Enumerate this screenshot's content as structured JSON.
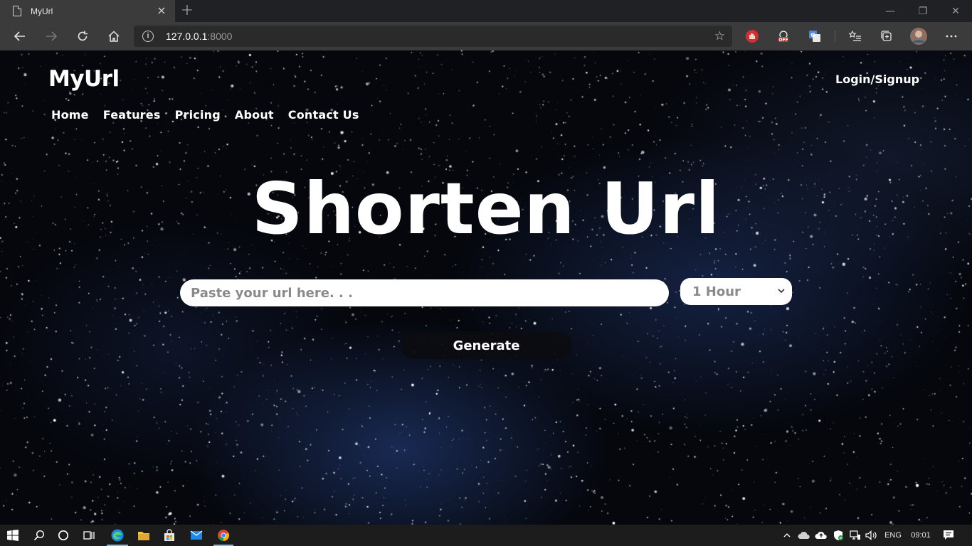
{
  "browser": {
    "tab_title": "MyUrl",
    "tab_close": "×",
    "new_tab": "+",
    "address_host": "127.0.0.1",
    "address_port": ":8000",
    "star_glyph": "☆",
    "window_controls": {
      "minimize": "—",
      "restore": "❐",
      "close": "✕"
    }
  },
  "site": {
    "brand": "MyUrl",
    "login_label": "Login/Signup",
    "nav": [
      "Home",
      "Features",
      "Pricing",
      "About",
      "Contact Us"
    ],
    "headline": "Shorten Url",
    "url_placeholder": "Paste your url here. . .",
    "duration_selected": "1 Hour",
    "generate_label": "Generate"
  },
  "taskbar": {
    "language": "ENG",
    "time": "09:01"
  },
  "colors": {
    "page_bg": "#05070d",
    "nebula_blue": "#28468c",
    "chrome_bg": "#3b3b3b",
    "tabbar_bg": "#202124",
    "taskbar_bg": "#1c1c1c",
    "accent_blue": "#7fb6e8"
  }
}
